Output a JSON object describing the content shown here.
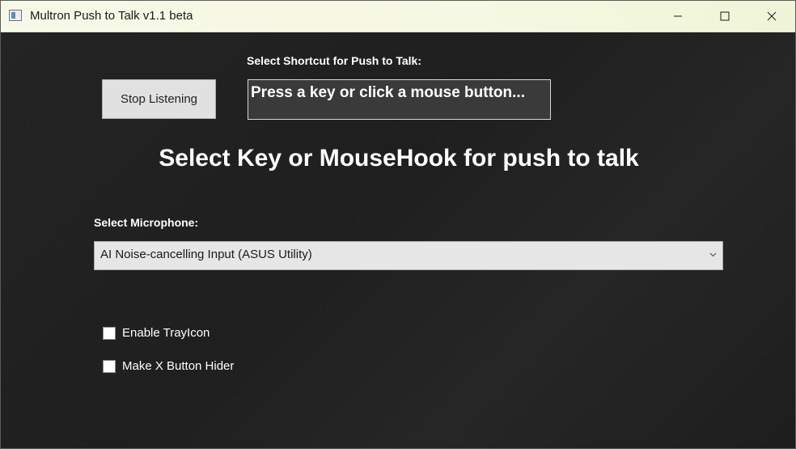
{
  "window": {
    "title": "Multron Push to Talk v1.1 beta",
    "controls": [
      "minimize-icon",
      "maximize-icon",
      "close-icon"
    ]
  },
  "shortcut": {
    "label": "Select Shortcut for Push to Talk:",
    "stop_button": "Stop Listening",
    "prompt": "Press a key or click a mouse button..."
  },
  "headline": "Select Key or MouseHook for push to talk",
  "microphone": {
    "label": "Select Microphone:",
    "selected": "AI Noise-cancelling Input (ASUS Utility)"
  },
  "options": {
    "tray_icon": {
      "label": "Enable TrayIcon",
      "checked": false
    },
    "x_button_hider": {
      "label": "Make X Button Hider",
      "checked": false
    }
  }
}
